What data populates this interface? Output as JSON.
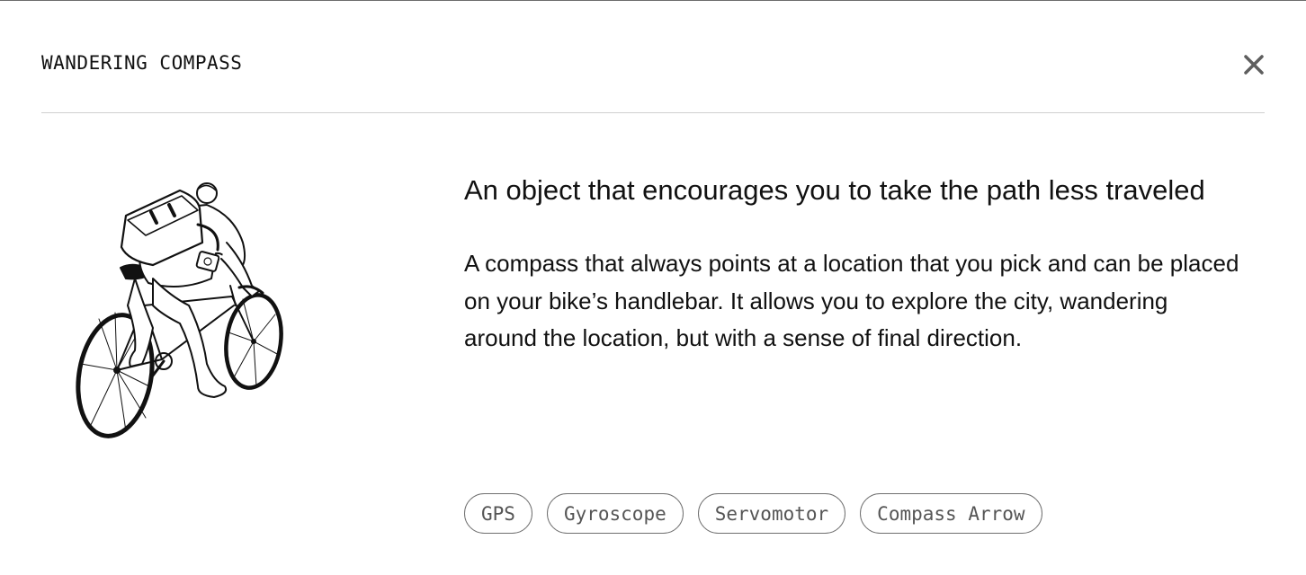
{
  "modal": {
    "title": "WANDERING COMPASS",
    "close_icon": "close-icon"
  },
  "illustration": {
    "icon": "cyclist-illustration"
  },
  "content": {
    "headline": "An object that encourages you to take the path less traveled",
    "description": "A compass that always points at a location that you pick and can be placed on your bike’s handlebar. It allows you to explore the city, wandering around the location, but with a sense of final direction."
  },
  "tags": [
    "GPS",
    "Gyroscope",
    "Servomotor",
    "Compass Arrow"
  ],
  "colors": {
    "text": "#111111",
    "tag_text": "#555555",
    "tag_border": "#6f6f6f",
    "divider": "#cfcfcf",
    "close_icon": "#5e5e5e"
  }
}
